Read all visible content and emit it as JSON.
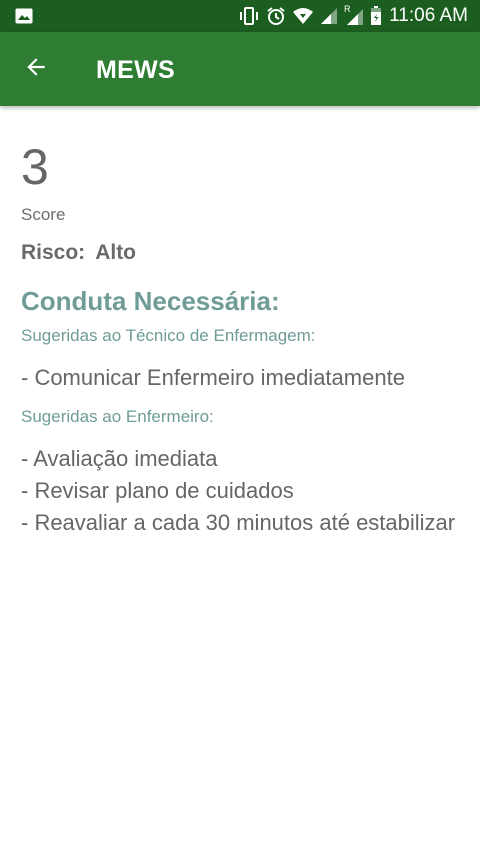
{
  "status_bar": {
    "time": "11:06 AM",
    "roaming_indicator": "R",
    "icons": [
      "image-icon",
      "vibrate-icon",
      "alarm-icon",
      "wifi-icon",
      "signal-icon",
      "signal-roaming-icon",
      "battery-icon"
    ]
  },
  "app_bar": {
    "back_icon": "arrow-left-icon",
    "title": "MEWS"
  },
  "score": {
    "value": "3",
    "label": "Score"
  },
  "risk": {
    "label": "Risco:",
    "value": "Alto"
  },
  "conduct": {
    "title": "Conduta Necessária:",
    "tecnico": {
      "heading": "Sugeridas ao Técnico de Enfermagem:",
      "items": [
        "- Comunicar Enfermeiro imediatamente"
      ]
    },
    "enfermeiro": {
      "heading": "Sugeridas ao Enfermeiro:",
      "items": [
        "- Avaliação imediata",
        "- Revisar plano de cuidados",
        "- Reavaliar a cada 30 minutos até estabilizar"
      ]
    }
  },
  "colors": {
    "status_bar": "#1b5e20",
    "app_bar": "#2e7d32",
    "accent_text": "#6f9c97",
    "body_text": "#666666"
  }
}
